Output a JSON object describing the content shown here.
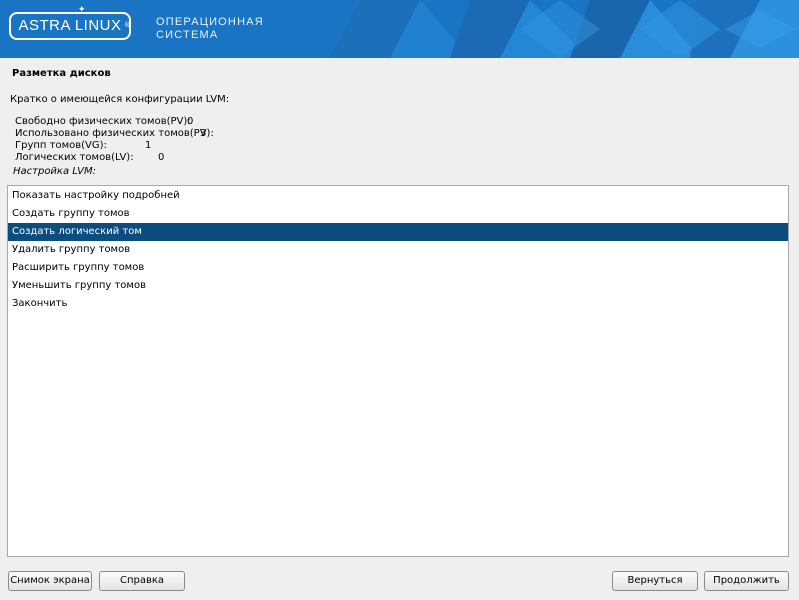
{
  "header": {
    "logo": "ASTRA LINUX",
    "registered_mark": "®",
    "os_line1": "ОПЕРАЦИОННАЯ",
    "os_line2": "СИСТЕМА"
  },
  "page_title": "Разметка дисков",
  "summary_intro": "Кратко о имеющейся конфигурации LVM:",
  "stats": [
    {
      "label": "Свободно физических томов(PV):",
      "value": "0"
    },
    {
      "label": "Использовано физических томов(PV):",
      "value": "3"
    },
    {
      "label": "Групп томов(VG):",
      "value": "1"
    },
    {
      "label": "Логических томов(LV):",
      "value": "0"
    }
  ],
  "lvm_caption": "Настройка LVM:",
  "menu": {
    "items": [
      "Показать настройку подробней",
      "Создать группу томов",
      "Создать логический том",
      "Удалить группу томов",
      "Расширить группу томов",
      "Уменьшить группу томов",
      "Закончить"
    ],
    "selected": "Создать логический том"
  },
  "buttons": {
    "screenshot": "Снимок экрана",
    "help": "Справка",
    "back": "Вернуться",
    "continue": "Продолжить"
  },
  "colors": {
    "header_blue": "#1a74c4",
    "selection": "#0c4d7f"
  }
}
